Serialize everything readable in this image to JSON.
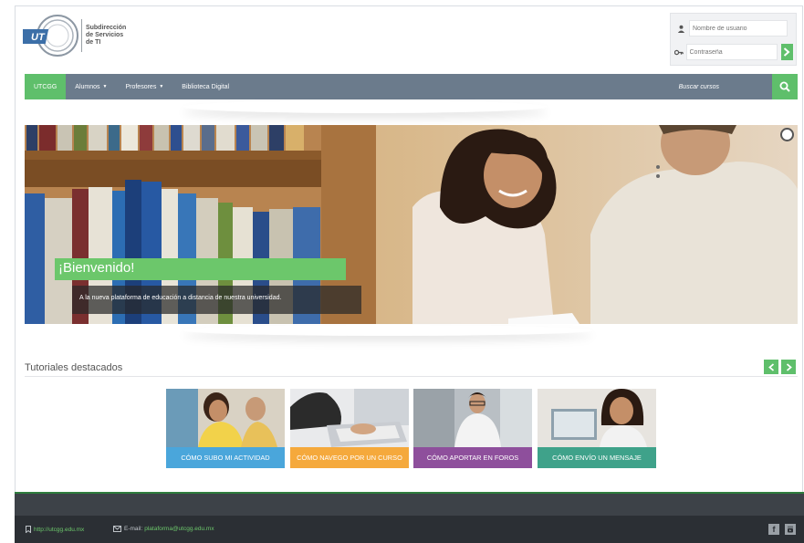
{
  "header": {
    "logo_mark": "UT",
    "logo_lines": [
      "Subdirección",
      "de Servicios",
      "de TI"
    ]
  },
  "login": {
    "username_placeholder": "Nombre de usuario",
    "password_placeholder": "Contraseña",
    "submit_icon": "chevron-right-icon"
  },
  "nav": {
    "items": [
      {
        "label": "UTCGG",
        "active": true,
        "dropdown": false
      },
      {
        "label": "Alumnos",
        "active": false,
        "dropdown": true
      },
      {
        "label": "Profesores",
        "active": false,
        "dropdown": true
      },
      {
        "label": "Biblioteca Digital",
        "active": false,
        "dropdown": false
      }
    ],
    "search_label": "Buscar cursos",
    "search_icon": "search-icon"
  },
  "hero": {
    "title": "¡Bienvenido!",
    "caption": "A la nueva plataforma de educación a distancia de nuestra universidad."
  },
  "tutorials": {
    "title": "Tutoriales destacados",
    "cards": [
      {
        "label": "CÓMO SUBO MI ACTIVIDAD",
        "color": "#4aa6db"
      },
      {
        "label": "CÓMO NAVEGO POR UN CURSO",
        "color": "#f5a93c"
      },
      {
        "label": "CÓMO APORTAR EN FOROS",
        "color": "#8e4f9c"
      },
      {
        "label": "CÓMO ENVÍO UN MENSAJE",
        "color": "#3fa28a"
      }
    ]
  },
  "footer": {
    "site_url": "http://utcgg.edu.mx",
    "email_label": "E-mail:",
    "email": "plataforma@utcgg.edu.mx",
    "social": [
      "facebook-icon",
      "youtube-icon"
    ]
  },
  "colors": {
    "accent_green": "#5fbf6b",
    "nav_gray": "#6b7b8c",
    "footer_dark": "#2b2f34"
  }
}
